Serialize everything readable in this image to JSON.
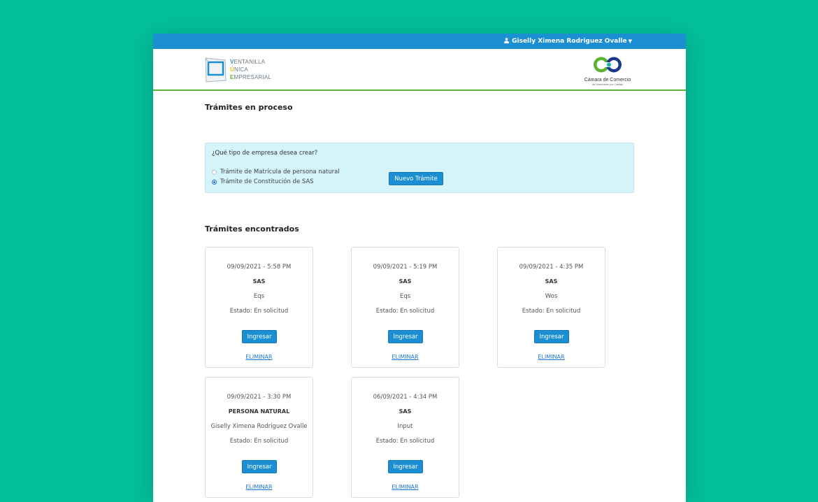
{
  "topbar": {
    "user_name": "Giselly Ximena Rodriguez Ovalle",
    "user_icon": "user-icon"
  },
  "header": {
    "vue_logo": {
      "line1_initial": "V",
      "line1_rest": "ENTANILLA",
      "line2_initial": "Ú",
      "line2_rest": "NICA",
      "line3_initial": "E",
      "line3_rest": "MPRESARIAL"
    },
    "ccm_logo": {
      "name": "Cámara de Comercio",
      "sub": "de Manizales por Caldas"
    }
  },
  "main": {
    "section1_title": "Trámites en proceso",
    "panel": {
      "question": "¿Qué tipo de empresa desea crear?",
      "options": [
        {
          "label": "Trámite de Matrícula de persona natural",
          "checked": false
        },
        {
          "label": "Trámite de Constitución de SAS",
          "checked": true
        }
      ],
      "button_label": "Nuevo Trámite"
    },
    "section2_title": "Trámites encontrados",
    "cards": [
      {
        "date": "09/09/2021 - 5:58 PM",
        "type": "SAS",
        "name": "Eqs",
        "status": "Estado: En solicitud",
        "button": "Ingresar",
        "link": "ELIMINAR"
      },
      {
        "date": "09/09/2021 - 5:19 PM",
        "type": "SAS",
        "name": "Eqs",
        "status": "Estado: En solicitud",
        "button": "Ingresar",
        "link": "ELIMINAR"
      },
      {
        "date": "09/09/2021 - 4:35 PM",
        "type": "SAS",
        "name": "Wos",
        "status": "Estado: En solicitud",
        "button": "Ingresar",
        "link": "ELIMINAR"
      },
      {
        "date": "09/09/2021 - 3:30 PM",
        "type": "PERSONA NATURAL",
        "name": "Giselly Ximena Rodriguez Ovalle",
        "status": "Estado: En solicitud",
        "button": "Ingresar",
        "link": "ELIMINAR"
      },
      {
        "date": "06/09/2021 - 4:34 PM",
        "type": "SAS",
        "name": "Input",
        "status": "Estado: En solicitud",
        "button": "Ingresar",
        "link": "ELIMINAR"
      }
    ]
  },
  "colors": {
    "background": "#03bf9a",
    "topbar": "#1b8fd2",
    "accent_green": "#5cb233",
    "panel": "#d4f3fa",
    "link": "#1b74d6"
  }
}
